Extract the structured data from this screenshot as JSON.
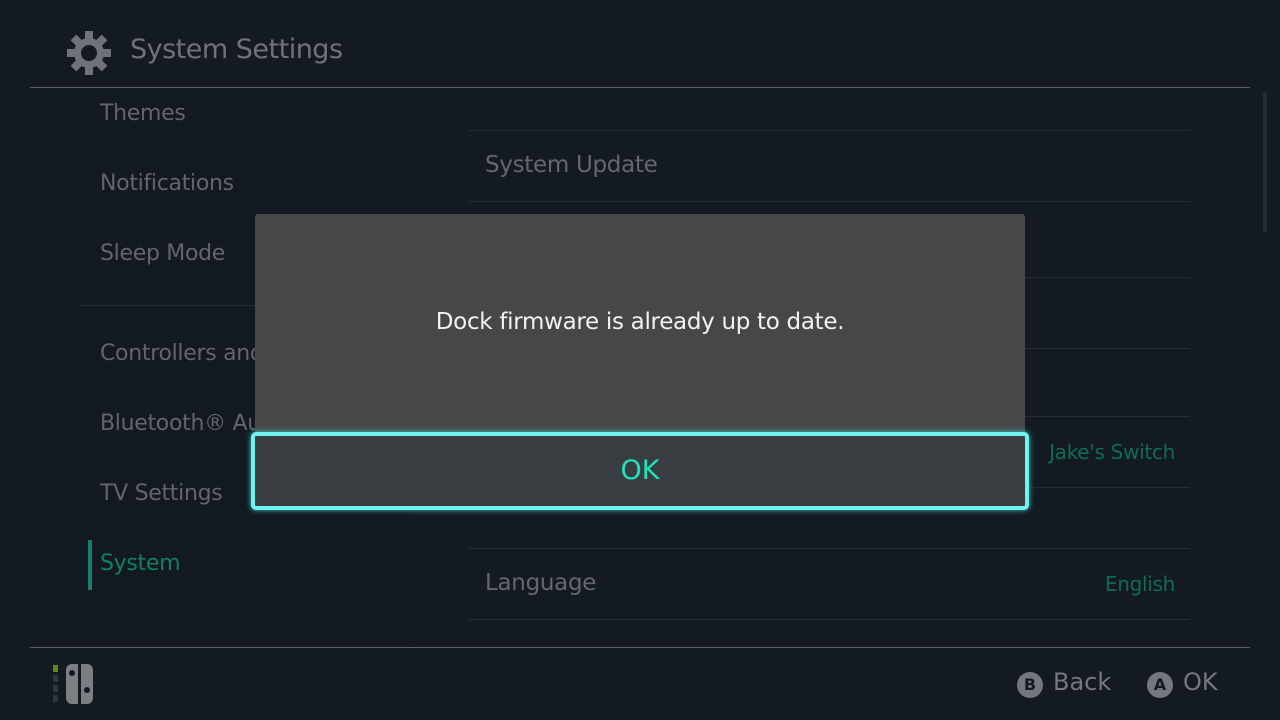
{
  "header": {
    "title": "System Settings",
    "icon": "gear-icon"
  },
  "sidebar": {
    "items": [
      {
        "label": "Themes"
      },
      {
        "label": "Notifications"
      },
      {
        "label": "Sleep Mode"
      },
      {
        "label": "Controllers and Sensors"
      },
      {
        "label": "Bluetooth® Audio"
      },
      {
        "label": "TV Settings"
      },
      {
        "label": "System",
        "selected": true
      }
    ]
  },
  "main": {
    "rows": [
      {
        "label": "System Update",
        "value": ""
      },
      {
        "label": "",
        "value": "Jake's Switch"
      },
      {
        "label": "Language",
        "value": "English"
      }
    ]
  },
  "dialog": {
    "message": "Dock firmware is already up to date.",
    "ok_label": "OK"
  },
  "footer": {
    "back_label": "Back",
    "back_key": "B",
    "ok_label": "OK",
    "ok_key": "A",
    "controller_player": 1
  },
  "colors": {
    "accent": "#1fe3b9",
    "focus_border": "#6ff3f1",
    "background": "#141a21",
    "dialog": "#474747"
  }
}
